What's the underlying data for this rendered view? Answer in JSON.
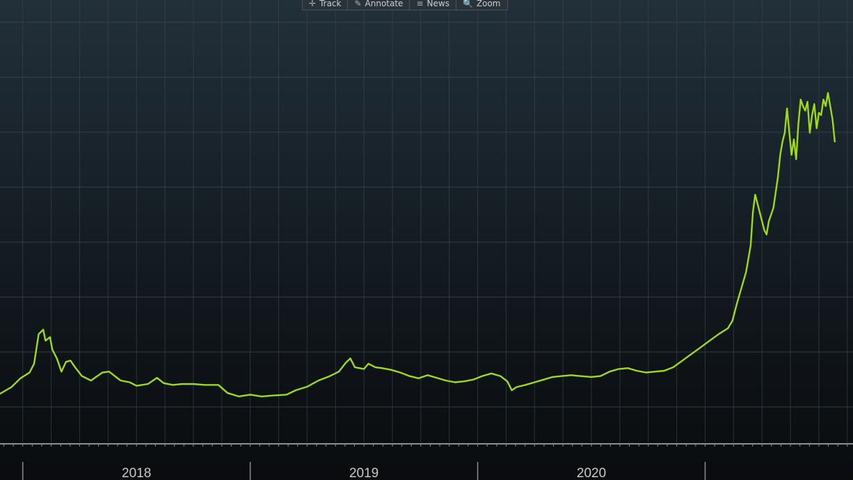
{
  "toolbar": {
    "items": [
      {
        "name": "track-button",
        "icon_name": "plus-icon",
        "icon": "✛",
        "label": "Track"
      },
      {
        "name": "annotate-button",
        "icon_name": "pencil-icon",
        "icon": "✎",
        "label": "Annotate"
      },
      {
        "name": "news-button",
        "icon_name": "news-icon",
        "icon": "≡",
        "label": "News"
      },
      {
        "name": "zoom-button",
        "icon_name": "magnifier-icon",
        "icon": "🔍",
        "label": "Zoom"
      }
    ]
  },
  "chart_data": {
    "type": "line",
    "title": "",
    "xlabel": "",
    "ylabel": "",
    "x_tick_labels": [
      "2018",
      "2019",
      "2020"
    ],
    "x_range": [
      2017.4,
      2021.15
    ],
    "y_range": [
      0,
      1
    ],
    "y_axis_visible": false,
    "grid": true,
    "legend": "none",
    "colors": {
      "line": "#9fdc16",
      "grid": "#3f4a52",
      "axis": "#8a8f94",
      "label": "#c9c9c9"
    },
    "series": [
      {
        "values_note": "",
        "points": [
          [
            2017.4,
            0.11
          ],
          [
            2017.45,
            0.125
          ],
          [
            2017.49,
            0.145
          ],
          [
            2017.53,
            0.158
          ],
          [
            2017.55,
            0.178
          ],
          [
            2017.57,
            0.245
          ],
          [
            2017.59,
            0.255
          ],
          [
            2017.6,
            0.23
          ],
          [
            2017.62,
            0.238
          ],
          [
            2017.63,
            0.21
          ],
          [
            2017.65,
            0.19
          ],
          [
            2017.67,
            0.16
          ],
          [
            2017.69,
            0.182
          ],
          [
            2017.71,
            0.185
          ],
          [
            2017.73,
            0.17
          ],
          [
            2017.76,
            0.15
          ],
          [
            2017.8,
            0.14
          ],
          [
            2017.85,
            0.158
          ],
          [
            2017.88,
            0.16
          ],
          [
            2017.93,
            0.14
          ],
          [
            2017.97,
            0.136
          ],
          [
            2018.0,
            0.128
          ],
          [
            2018.05,
            0.132
          ],
          [
            2018.09,
            0.146
          ],
          [
            2018.12,
            0.134
          ],
          [
            2018.16,
            0.13
          ],
          [
            2018.2,
            0.132
          ],
          [
            2018.25,
            0.132
          ],
          [
            2018.3,
            0.13
          ],
          [
            2018.36,
            0.13
          ],
          [
            2018.4,
            0.112
          ],
          [
            2018.45,
            0.104
          ],
          [
            2018.5,
            0.108
          ],
          [
            2018.55,
            0.104
          ],
          [
            2018.6,
            0.106
          ],
          [
            2018.66,
            0.108
          ],
          [
            2018.7,
            0.118
          ],
          [
            2018.75,
            0.126
          ],
          [
            2018.8,
            0.14
          ],
          [
            2018.85,
            0.15
          ],
          [
            2018.89,
            0.16
          ],
          [
            2018.92,
            0.18
          ],
          [
            2018.94,
            0.19
          ],
          [
            2018.96,
            0.17
          ],
          [
            2019.0,
            0.166
          ],
          [
            2019.02,
            0.178
          ],
          [
            2019.05,
            0.17
          ],
          [
            2019.08,
            0.168
          ],
          [
            2019.12,
            0.164
          ],
          [
            2019.16,
            0.158
          ],
          [
            2019.2,
            0.15
          ],
          [
            2019.24,
            0.145
          ],
          [
            2019.28,
            0.152
          ],
          [
            2019.32,
            0.146
          ],
          [
            2019.36,
            0.14
          ],
          [
            2019.4,
            0.136
          ],
          [
            2019.44,
            0.138
          ],
          [
            2019.48,
            0.142
          ],
          [
            2019.52,
            0.15
          ],
          [
            2019.56,
            0.156
          ],
          [
            2019.6,
            0.15
          ],
          [
            2019.63,
            0.138
          ],
          [
            2019.65,
            0.118
          ],
          [
            2019.67,
            0.125
          ],
          [
            2019.71,
            0.13
          ],
          [
            2019.75,
            0.136
          ],
          [
            2019.79,
            0.142
          ],
          [
            2019.83,
            0.148
          ],
          [
            2019.87,
            0.15
          ],
          [
            2019.91,
            0.152
          ],
          [
            2019.95,
            0.15
          ],
          [
            2020.0,
            0.148
          ],
          [
            2020.04,
            0.15
          ],
          [
            2020.08,
            0.16
          ],
          [
            2020.12,
            0.166
          ],
          [
            2020.16,
            0.168
          ],
          [
            2020.2,
            0.162
          ],
          [
            2020.24,
            0.158
          ],
          [
            2020.28,
            0.16
          ],
          [
            2020.32,
            0.162
          ],
          [
            2020.36,
            0.17
          ],
          [
            2020.4,
            0.185
          ],
          [
            2020.44,
            0.2
          ],
          [
            2020.48,
            0.215
          ],
          [
            2020.52,
            0.23
          ],
          [
            2020.56,
            0.245
          ],
          [
            2020.6,
            0.258
          ],
          [
            2020.62,
            0.275
          ],
          [
            2020.64,
            0.315
          ],
          [
            2020.66,
            0.35
          ],
          [
            2020.68,
            0.385
          ],
          [
            2020.7,
            0.445
          ],
          [
            2020.71,
            0.52
          ],
          [
            2020.72,
            0.56
          ],
          [
            2020.73,
            0.54
          ],
          [
            2020.75,
            0.5
          ],
          [
            2020.76,
            0.48
          ],
          [
            2020.77,
            0.47
          ],
          [
            2020.78,
            0.5
          ],
          [
            2020.8,
            0.53
          ],
          [
            2020.82,
            0.6
          ],
          [
            2020.83,
            0.65
          ],
          [
            2020.84,
            0.68
          ],
          [
            2020.85,
            0.7
          ],
          [
            2020.86,
            0.755
          ],
          [
            2020.87,
            0.7
          ],
          [
            2020.88,
            0.65
          ],
          [
            2020.89,
            0.685
          ],
          [
            2020.9,
            0.64
          ],
          [
            2020.91,
            0.72
          ],
          [
            2020.92,
            0.775
          ],
          [
            2020.93,
            0.76
          ],
          [
            2020.94,
            0.75
          ],
          [
            2020.95,
            0.77
          ],
          [
            2020.96,
            0.7
          ],
          [
            2020.97,
            0.74
          ],
          [
            2020.98,
            0.765
          ],
          [
            2020.99,
            0.71
          ],
          [
            2021.0,
            0.745
          ],
          [
            2021.01,
            0.74
          ],
          [
            2021.02,
            0.775
          ],
          [
            2021.03,
            0.76
          ],
          [
            2021.04,
            0.79
          ],
          [
            2021.05,
            0.76
          ],
          [
            2021.06,
            0.73
          ],
          [
            2021.07,
            0.68
          ]
        ]
      }
    ]
  }
}
